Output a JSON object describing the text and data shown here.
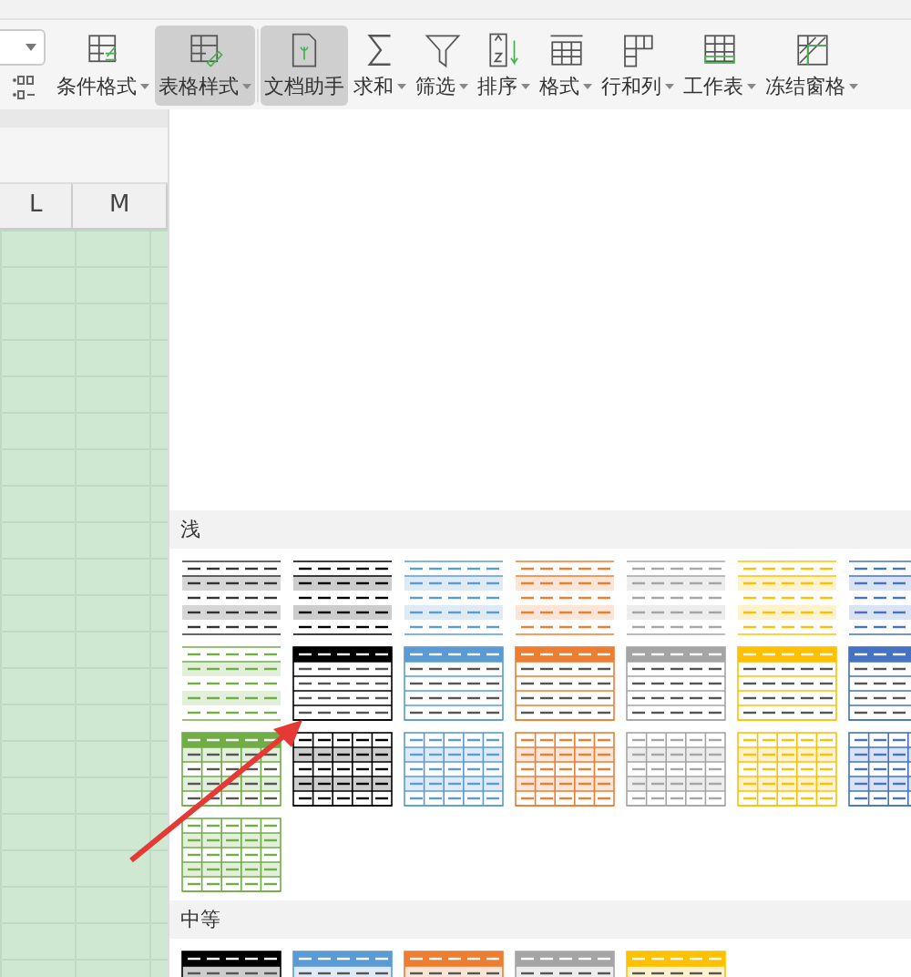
{
  "toolbar": {
    "buttons": [
      {
        "label": "条件格式",
        "kind": "conditional",
        "dropdown": true,
        "selected": false
      },
      {
        "label": "表格样式",
        "kind": "tablestyle",
        "dropdown": true,
        "selected": true
      },
      {
        "label": "文档助手",
        "kind": "assistant",
        "dropdown": false,
        "selected": true
      },
      {
        "label": "求和",
        "kind": "sum",
        "dropdown": true,
        "selected": false
      },
      {
        "label": "筛选",
        "kind": "filter",
        "dropdown": true,
        "selected": false
      },
      {
        "label": "排序",
        "kind": "sort",
        "dropdown": true,
        "selected": false
      },
      {
        "label": "格式",
        "kind": "format",
        "dropdown": true,
        "selected": false
      },
      {
        "label": "行和列",
        "kind": "rowcol",
        "dropdown": true,
        "selected": false
      },
      {
        "label": "工作表",
        "kind": "sheet",
        "dropdown": true,
        "selected": false
      },
      {
        "label": "冻结窗格",
        "kind": "freeze",
        "dropdown": true,
        "selected": false
      }
    ]
  },
  "sheet": {
    "columns": [
      "L",
      "M"
    ]
  },
  "style_panel": {
    "sections": [
      {
        "title": "浅",
        "styles": [
          {
            "kind": "banded",
            "color": "#333333"
          },
          {
            "kind": "banded",
            "color": "#000000"
          },
          {
            "kind": "banded",
            "color": "#5b9bd5"
          },
          {
            "kind": "banded",
            "color": "#ed7d31"
          },
          {
            "kind": "banded",
            "color": "#a5a5a5"
          },
          {
            "kind": "banded",
            "color": "#ffc000"
          },
          {
            "kind": "banded",
            "color": "#4472c4"
          },
          {
            "kind": "banded",
            "color": "#70ad47"
          },
          {
            "kind": "header",
            "color": "#000000"
          },
          {
            "kind": "header",
            "color": "#5b9bd5"
          },
          {
            "kind": "header",
            "color": "#ed7d31"
          },
          {
            "kind": "header",
            "color": "#a5a5a5"
          },
          {
            "kind": "header",
            "color": "#ffc000"
          },
          {
            "kind": "header",
            "color": "#4472c4"
          },
          {
            "kind": "gridheader",
            "color": "#70ad47"
          },
          {
            "kind": "grid",
            "color": "#000000"
          },
          {
            "kind": "grid",
            "color": "#5b9bd5"
          },
          {
            "kind": "grid",
            "color": "#ed7d31"
          },
          {
            "kind": "grid",
            "color": "#a5a5a5"
          },
          {
            "kind": "grid",
            "color": "#ffc000"
          },
          {
            "kind": "grid",
            "color": "#4472c4"
          },
          {
            "kind": "grid",
            "color": "#70ad47"
          }
        ]
      },
      {
        "title": "中等",
        "styles": [
          {
            "kind": "medium",
            "color": "#000000"
          },
          {
            "kind": "medium",
            "color": "#5b9bd5"
          },
          {
            "kind": "medium",
            "color": "#ed7d31"
          },
          {
            "kind": "medium",
            "color": "#a5a5a5"
          },
          {
            "kind": "medium",
            "color": "#ffc000"
          }
        ]
      }
    ]
  }
}
